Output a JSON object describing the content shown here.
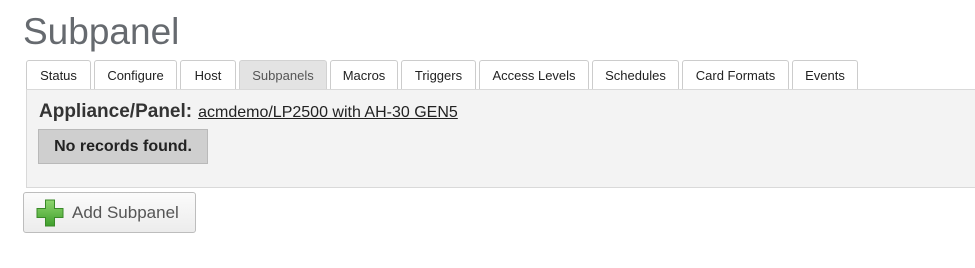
{
  "page": {
    "title": "Subpanel"
  },
  "tabs": [
    {
      "label": "Status",
      "active": false
    },
    {
      "label": "Configure",
      "active": false
    },
    {
      "label": "Host",
      "active": false
    },
    {
      "label": "Subpanels",
      "active": true
    },
    {
      "label": "Macros",
      "active": false
    },
    {
      "label": "Triggers",
      "active": false
    },
    {
      "label": "Access Levels",
      "active": false
    },
    {
      "label": "Schedules",
      "active": false
    },
    {
      "label": "Card Formats",
      "active": false
    },
    {
      "label": "Events",
      "active": false
    }
  ],
  "panel": {
    "appliance_label": "Appliance/Panel:",
    "appliance_link": "acmdemo/LP2500 with AH-30 GEN5",
    "empty_message": "No records found."
  },
  "actions": {
    "add_label": "Add Subpanel",
    "add_icon": "plus-icon"
  },
  "colors": {
    "plus_green": "#5cb85c",
    "active_tab": "#e3e3e3",
    "panel_bg": "#f3f3f3"
  }
}
